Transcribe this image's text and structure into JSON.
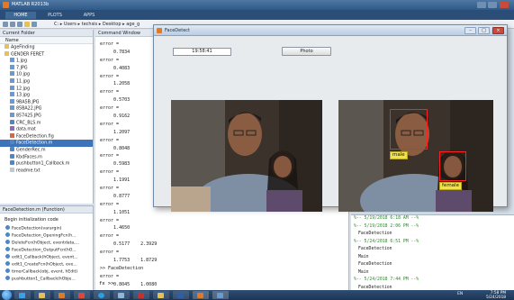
{
  "matlab": {
    "title": "MATLAB R2013b",
    "tabs": [
      "HOME",
      "PLOTS",
      "APPS"
    ],
    "breadcrumb": [
      "C:",
      "Users",
      "techsis",
      "Desktop",
      "age_g"
    ]
  },
  "current_folder": {
    "title": "Current Folder",
    "column_header": "Name",
    "items": [
      {
        "name": "AgeFinding",
        "type": "folder"
      },
      {
        "name": "GENDER FERET",
        "type": "folder"
      },
      {
        "name": "1.jpg",
        "type": "img"
      },
      {
        "name": "7.JPG",
        "type": "img"
      },
      {
        "name": "10.jpg",
        "type": "img"
      },
      {
        "name": "11.jpg",
        "type": "img"
      },
      {
        "name": "12.jpg",
        "type": "img"
      },
      {
        "name": "13.jpg",
        "type": "img"
      },
      {
        "name": "9BA5B.JPG",
        "type": "img"
      },
      {
        "name": "85BA22.JPG",
        "type": "img"
      },
      {
        "name": "857425.JPG",
        "type": "img"
      },
      {
        "name": "CRC_BLS.m",
        "type": "m"
      },
      {
        "name": "data.mat",
        "type": "mat"
      },
      {
        "name": "FaceDetection.fig",
        "type": "fig"
      },
      {
        "name": "FaceDetection.m",
        "type": "m",
        "selected": true
      },
      {
        "name": "GenderRec.m",
        "type": "m"
      },
      {
        "name": "KbdFaces.m",
        "type": "m"
      },
      {
        "name": "pushbutton1_Callback.m",
        "type": "m"
      },
      {
        "name": "readme.txt",
        "type": "txt"
      }
    ]
  },
  "function_panel": {
    "title": "FaceDetection.m (Function)",
    "begin_text": "Begin initialization code",
    "items": [
      "FaceDetection(varargin)",
      "FaceDetection_OpeningFcn(h...",
      "DeleteFcn(hObject, eventdata,...",
      "FaceDetection_OutputFcn(hO...",
      "edit1_Callback(hObject, event...",
      "edit1_CreateFcn(hObject, eve...",
      "timerCallback(obj, event, hEdit)",
      "pushbutton1_Callback(hObje..."
    ]
  },
  "command_window": {
    "title": "Command Window",
    "lines": [
      "error =",
      "     0.7834",
      "error =",
      "     0.4083",
      "error =",
      "     1.2058",
      "error =",
      "     0.5703",
      "error =",
      "     0.9162",
      "error =",
      "     1.2097",
      "error =",
      "     0.8048",
      "error =",
      "     0.5983",
      "error =",
      "     1.1991",
      "error =",
      "     0.8777",
      "error =",
      "     1.1051",
      "error =",
      "     1.4650",
      "error =",
      "     0.5177    2.3929",
      "error =",
      "     1.7753    1.8729",
      ">> FaceDetection",
      "error =",
      "     0.8045    1.0080",
      "error =",
      "     0.7527    0.1865"
    ],
    "prompt": "fx >>"
  },
  "history": {
    "lines": [
      {
        "text": "%-- 5/19/2018 6:18 AM --%",
        "session": true
      },
      {
        "text": "%-- 5/19/2018 2:06 PM --%",
        "session": true
      },
      {
        "text": "FaceDetection",
        "session": false
      },
      {
        "text": "%-- 5/24/2018 6:51 PM --%",
        "session": true
      },
      {
        "text": "FaceDetection",
        "session": false
      },
      {
        "text": "Main",
        "session": false
      },
      {
        "text": "FaceDetection",
        "session": false
      },
      {
        "text": "Main",
        "session": false
      },
      {
        "text": "%-- 5/24/2018 7:44 PM --%",
        "session": true
      },
      {
        "text": "FaceDetection",
        "session": false
      }
    ]
  },
  "face_window": {
    "title": "FaceDetect",
    "time_value": "19:58:41",
    "photo_button": "Photo",
    "labels": {
      "male": "male",
      "female": "female"
    }
  },
  "taskbar": {
    "tray": "EN",
    "time": "7:58 PM",
    "date": "5/24/2018"
  },
  "colors": {
    "detection_box": "#ff2020",
    "label_bg": "#f2e24a",
    "taskbar": "#1c3555",
    "ribbon": "#2b4e79"
  }
}
